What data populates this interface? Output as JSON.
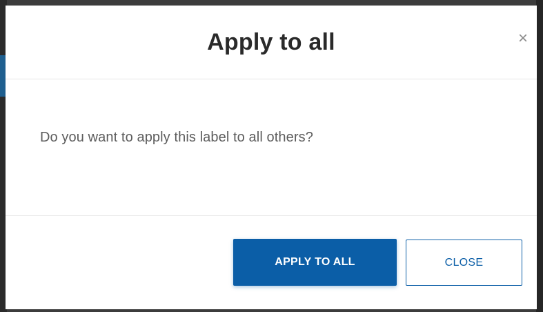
{
  "dialog": {
    "title": "Apply to all",
    "close_glyph": "×",
    "close_icon": "close-icon",
    "message": "Do you want to apply this label to all others?",
    "primary_button_label": "APPLY TO ALL",
    "secondary_button_label": "CLOSE"
  },
  "colors": {
    "primary": "#0b5ea7",
    "title_text": "#2a2a2a",
    "body_text": "#5c5c5c",
    "divider": "#e6e6e6"
  }
}
